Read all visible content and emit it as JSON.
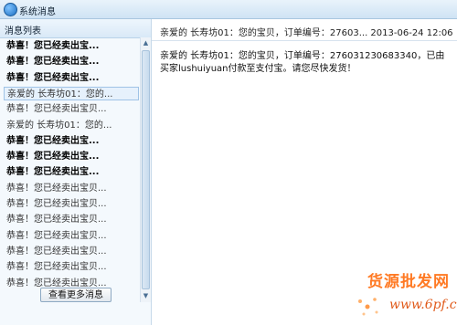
{
  "window": {
    "title": "系统消息"
  },
  "list": {
    "header": "消息列表",
    "items": [
      {
        "text": "恭喜！您已经卖出宝...",
        "unread": true
      },
      {
        "text": "恭喜！您已经卖出宝...",
        "unread": true
      },
      {
        "text": "恭喜！您已经卖出宝...",
        "unread": true
      },
      {
        "text": "亲爱的 长寿坊01：您的...",
        "selected": true
      },
      {
        "text": "恭喜！您已经卖出宝贝..."
      },
      {
        "text": "亲爱的 长寿坊01：您的..."
      },
      {
        "text": "恭喜！您已经卖出宝...",
        "unread": true
      },
      {
        "text": "恭喜！您已经卖出宝...",
        "unread": true
      },
      {
        "text": "恭喜！您已经卖出宝...",
        "unread": true
      },
      {
        "text": "恭喜！您已经卖出宝贝..."
      },
      {
        "text": "恭喜！您已经卖出宝贝..."
      },
      {
        "text": "恭喜！您已经卖出宝贝..."
      },
      {
        "text": "恭喜！您已经卖出宝贝..."
      },
      {
        "text": "恭喜！您已经卖出宝贝..."
      },
      {
        "text": "恭喜！您已经卖出宝贝..."
      },
      {
        "text": "恭喜！您已经卖出宝贝..."
      }
    ],
    "more_button": "查看更多消息"
  },
  "detail": {
    "header": "亲爱的 长寿坊01：您的宝贝，订单编号：27603...  2013-06-24 12:06",
    "body": "亲爱的 长寿坊01：您的宝贝，订单编号：276031230683340，已由买家lushuiyuan付款至支付宝。请您尽快发货！"
  },
  "watermark": {
    "text": "货源批发网",
    "url": "www.6pf.cn"
  },
  "colors": {
    "accent": "#1c6fc2",
    "watermark": "#ff7a24"
  }
}
